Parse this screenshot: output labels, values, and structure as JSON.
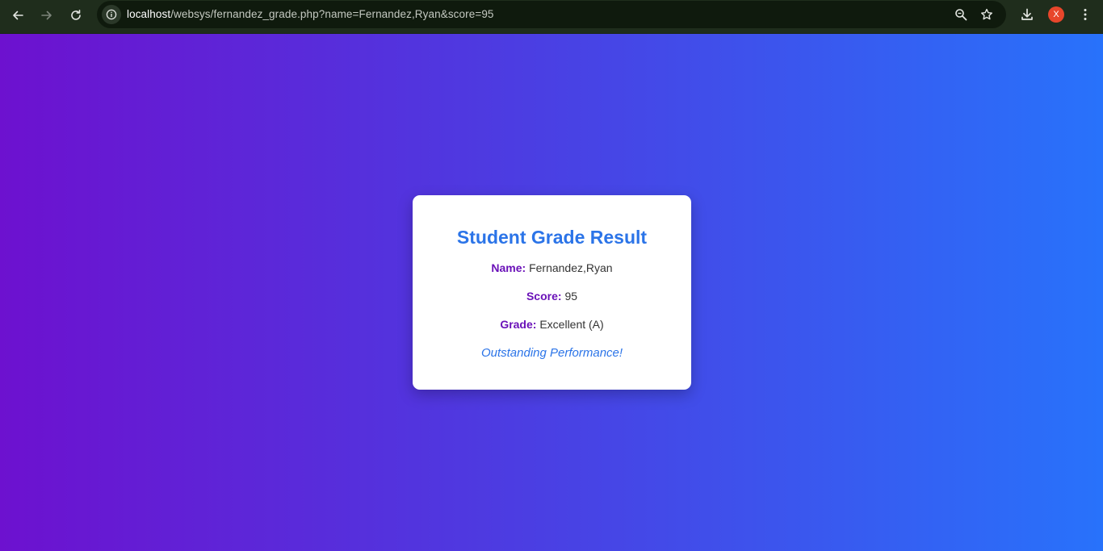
{
  "browser": {
    "url_host": "localhost",
    "url_path": "/websys/fernandez_grade.php?name=Fernandez,Ryan&score=95",
    "avatar_letter": "X",
    "icons": [
      "back-icon",
      "forward-icon",
      "reload-icon",
      "site-info-icon",
      "zoom-icon",
      "bookmark-star-icon",
      "download-icon",
      "menu-icon"
    ]
  },
  "card": {
    "title": "Student Grade Result",
    "name_label": "Name:",
    "name_value": "Fernandez,Ryan",
    "score_label": "Score:",
    "score_value": "95",
    "grade_label": "Grade:",
    "grade_value": "Excellent (A)",
    "message": "Outstanding Performance!"
  },
  "colors": {
    "gradient_start": "#6d11cf",
    "gradient_end": "#2872fb",
    "title_color": "#2b74e8",
    "label_color": "#6a11b8",
    "browser_bar": "#1f2d1c"
  }
}
